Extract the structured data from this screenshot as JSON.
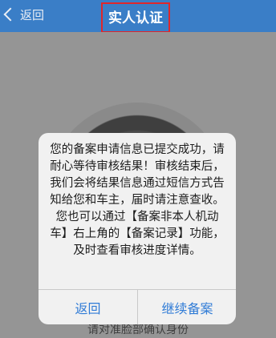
{
  "nav": {
    "back_label": "返回",
    "title": "实人认证"
  },
  "scan": {
    "instruction": "请对准脸部确认身份"
  },
  "dialog": {
    "message": "您的备案申请信息已提交成功，请耐心等待审核结果！审核结束后，我们会将结果信息通过短信方式告知给您和车主，届时请注意查收。您也可以通过【备案非本人机动车】右上角的【备案记录】功能，及时查看审核进度详情。",
    "cancel_label": "返回",
    "confirm_label": "继续备案"
  },
  "colors": {
    "nav_bar": "#3a7ec7",
    "highlight_border": "#e0262a",
    "dialog_button_text": "#2f7bd6"
  }
}
